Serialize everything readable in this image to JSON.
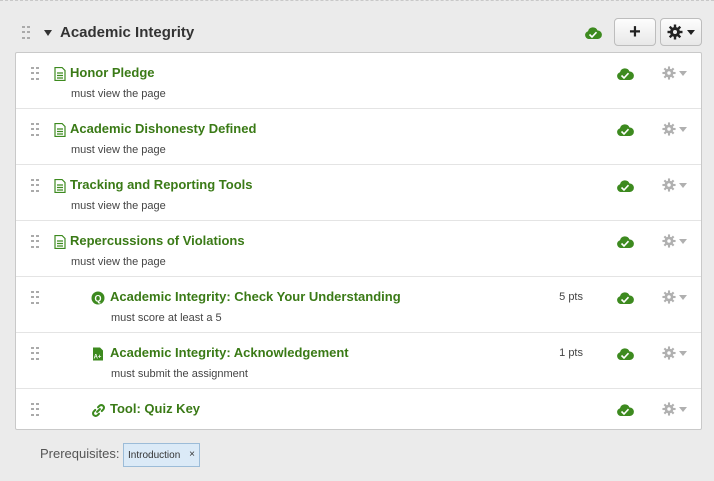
{
  "module": {
    "title": "Academic Integrity",
    "add_label": "+",
    "published": true
  },
  "items": [
    {
      "type": "page",
      "title": "Honor Pledge",
      "requirement": "must view the page",
      "points": ""
    },
    {
      "type": "page",
      "title": "Academic Dishonesty Defined",
      "requirement": "must view the page",
      "points": ""
    },
    {
      "type": "page",
      "title": "Tracking and Reporting Tools",
      "requirement": "must view the page",
      "points": ""
    },
    {
      "type": "page",
      "title": "Repercussions of Violations",
      "requirement": "must view the page",
      "points": ""
    },
    {
      "type": "quiz",
      "title": "Academic Integrity: Check Your Understanding",
      "requirement": "must score at least a 5",
      "points": "5 pts"
    },
    {
      "type": "assignment",
      "title": "Academic Integrity: Acknowledgement",
      "requirement": "must submit the assignment",
      "points": "1 pts"
    },
    {
      "type": "external-tool",
      "title": "Tool: Quiz Key",
      "requirement": "",
      "points": ""
    }
  ],
  "prerequisites": {
    "label": "Prerequisites:",
    "tags": [
      {
        "label": "Introduction",
        "remove": "×"
      }
    ]
  },
  "colors": {
    "title_green": "#3a7a16",
    "published_green": "#3d8a1f",
    "background": "#ebebeb"
  },
  "icons": {
    "page": "document-icon",
    "quiz": "quiz-icon",
    "assignment": "assignment-icon",
    "external-tool": "link-icon",
    "published": "cloud-check-icon",
    "settings": "gear-icon"
  }
}
